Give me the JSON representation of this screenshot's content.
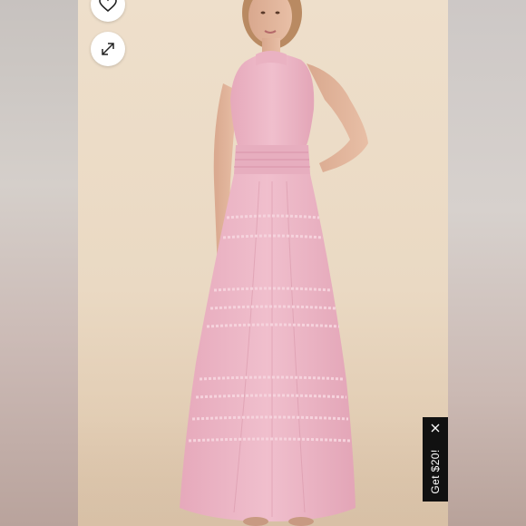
{
  "toolbar": {
    "favorite_icon": "heart-icon",
    "expand_icon": "expand-arrows-icon"
  },
  "promo": {
    "label": "Get $20!",
    "close_icon": "close-icon"
  },
  "colors": {
    "backdrop": "#e9dccb",
    "dress": "#e8b3c3",
    "promo_bg": "#111111"
  }
}
